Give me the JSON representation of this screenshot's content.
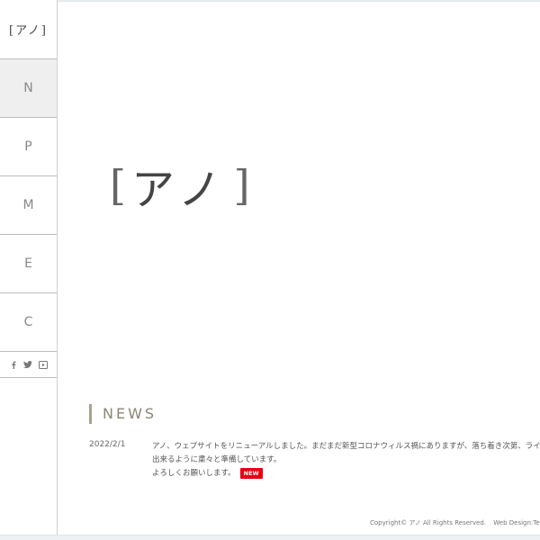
{
  "sidebar": {
    "logo": "[アノ]",
    "nav": [
      {
        "label": "N",
        "active": true
      },
      {
        "label": "P",
        "active": false
      },
      {
        "label": "M",
        "active": false
      },
      {
        "label": "E",
        "active": false
      },
      {
        "label": "C",
        "active": false
      }
    ],
    "social_icons": [
      "facebook-icon",
      "twitter-icon",
      "youtube-icon"
    ]
  },
  "hero": {
    "open_bracket": "[",
    "name": "アノ",
    "close_bracket": "]"
  },
  "news": {
    "heading": "NEWS",
    "items": [
      {
        "date": "2022/2/1",
        "line1": "アノ、ウェブサイトをリニューアルしました。まだまだ新型コロナウィルス禍にありますが、落ち着き次第、ライブやイベン",
        "line2": "出来るように粛々と準備しています。",
        "line3": "よろしくお願いします。",
        "badge": "NEW"
      }
    ]
  },
  "footer": {
    "copyright": "Copyright© アノ All Rights Reserved.",
    "credit": "Web Design:Templa"
  },
  "colors": {
    "accent_bar": "#a9a18c",
    "badge": "#e60012",
    "active_nav": "#efefef"
  }
}
